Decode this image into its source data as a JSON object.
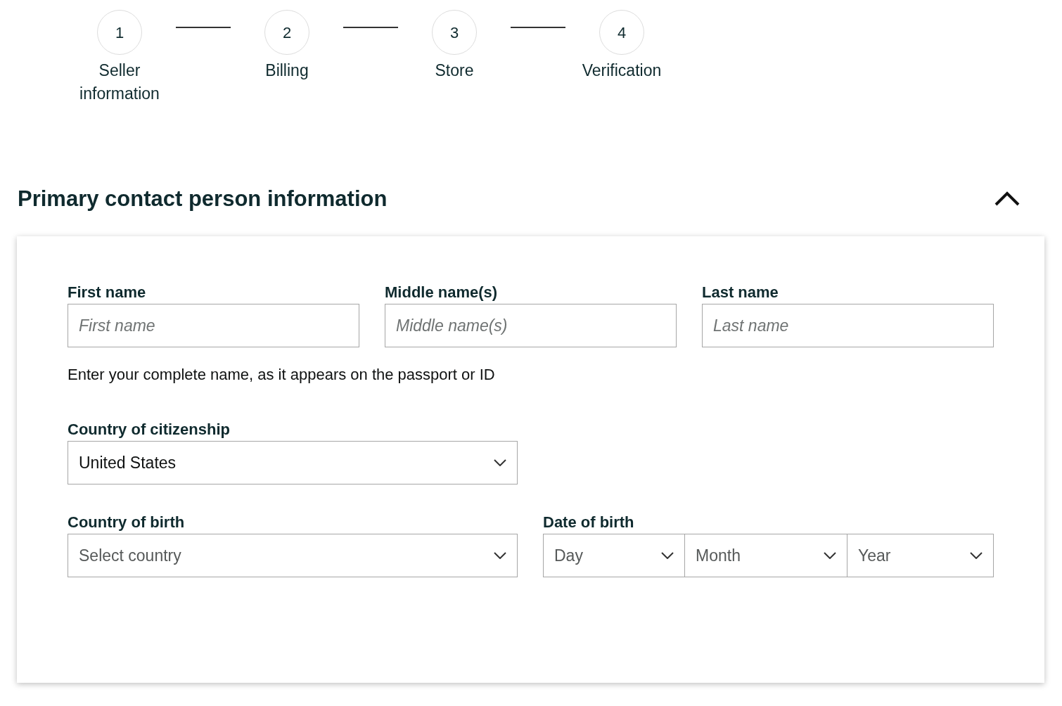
{
  "steps": [
    {
      "number": "1",
      "label": "Seller information"
    },
    {
      "number": "2",
      "label": "Billing"
    },
    {
      "number": "3",
      "label": "Store"
    },
    {
      "number": "4",
      "label": "Verification"
    }
  ],
  "section": {
    "title": "Primary contact person information",
    "expanded": true
  },
  "name_fields": [
    {
      "label": "First name",
      "placeholder": "First name"
    },
    {
      "label": "Middle name(s)",
      "placeholder": "Middle name(s)"
    },
    {
      "label": "Last name",
      "placeholder": "Last name"
    }
  ],
  "name_hint": "Enter your complete name, as it appears on the passport or ID",
  "citizenship": {
    "label": "Country of citizenship",
    "value": "United States"
  },
  "birth_country": {
    "label": "Country of birth",
    "placeholder": "Select country"
  },
  "date_of_birth": {
    "label": "Date of birth",
    "parts": [
      {
        "placeholder": "Day"
      },
      {
        "placeholder": "Month"
      },
      {
        "placeholder": "Year"
      }
    ]
  }
}
